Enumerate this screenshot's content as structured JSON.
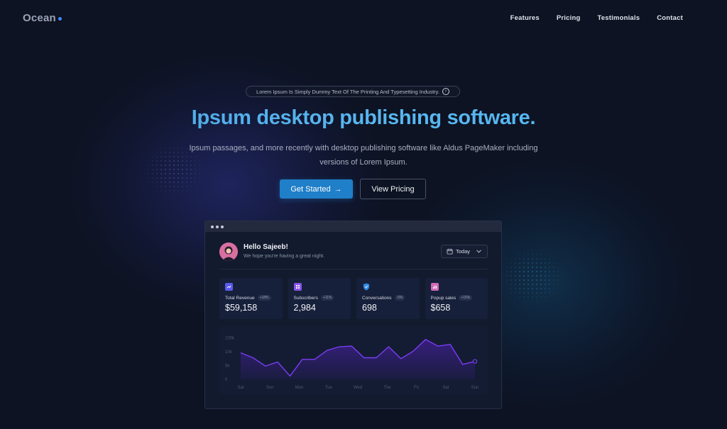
{
  "nav": {
    "logo": "Ocean",
    "links": [
      "Features",
      "Pricing",
      "Testimonials",
      "Contact"
    ]
  },
  "hero": {
    "pill_text": "Lorem Ipsum Is Simply Dummy Text Of The Printing And Typesetting Industry.",
    "headline": "Ipsum desktop publishing software.",
    "subtext": "Ipsum passages, and more recently with desktop publishing software like Aldus PageMaker including versions of Lorem Ipsum.",
    "primary_button": "Get Started",
    "primary_arrow": "→",
    "secondary_button": "View Pricing"
  },
  "dashboard": {
    "greeting": "Hello Sajeeb!",
    "greeting_sub": "We hope you're having a great night.",
    "date_filter": "Today",
    "cards": [
      {
        "label": "Total Revenue",
        "badge": "+18%",
        "value": "$59,158",
        "icon": "revenue-icon",
        "color": "#5b5bf0"
      },
      {
        "label": "Subscribers",
        "badge": "+11%",
        "value": "2,984",
        "icon": "subscribers-icon",
        "color": "#8a55ea"
      },
      {
        "label": "Conversations",
        "badge": "-5%",
        "value": "698",
        "icon": "shield-icon",
        "color": "#2f8de4"
      },
      {
        "label": "Popup sales",
        "badge": "+15%",
        "value": "$658",
        "icon": "chart-icon",
        "color": "#d06ab8"
      }
    ]
  },
  "chart_data": {
    "type": "area",
    "x": [
      "Sat",
      "Sun",
      "Mon",
      "Tue",
      "Wed",
      "The",
      "Fri",
      "Sat",
      "Sun"
    ],
    "y_ticks": [
      "100k",
      "10k",
      "5k",
      "0"
    ],
    "values": [
      8,
      6.5,
      4,
      5.2,
      1,
      6,
      6,
      8.7,
      9.8,
      10,
      6.5,
      6.5,
      9.8,
      6.2,
      8.5,
      12,
      10,
      10.5,
      4.5,
      5.4
    ],
    "line_color": "#7a3cf5",
    "fill_color": "#3d1f8a"
  },
  "colors": {
    "background": "#0d1322",
    "accent": "#1f7fc8",
    "headline": "#4aa8e8"
  }
}
